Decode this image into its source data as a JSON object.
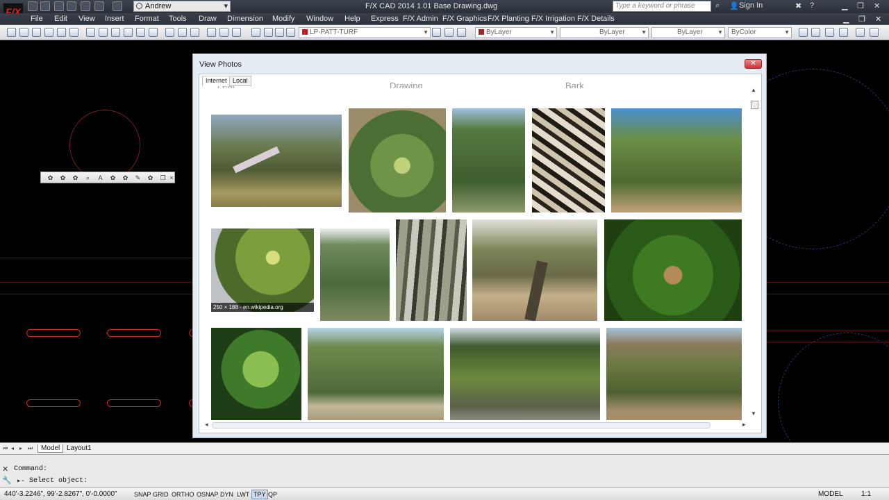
{
  "app": {
    "logo": "F/X",
    "title": "F/X CAD 2014    1.01 Base Drawing.dwg",
    "workspace": "Andrew",
    "search_placeholder": "Type a keyword or phrase",
    "sign_in": "Sign In"
  },
  "menu": [
    "File",
    "Edit",
    "View",
    "Insert",
    "Format",
    "Tools",
    "Draw",
    "Dimension",
    "Modify",
    "Window",
    "Help",
    "Express",
    "F/X Admin",
    "F/X Graphics",
    "F/X Planting",
    "F/X Irrigation",
    "F/X Details"
  ],
  "toolbar": {
    "layer": "LP-PATT-TURF",
    "color": "ByLayer",
    "linetype": "ByLayer",
    "lineweight": "ByLayer",
    "plotstyle": "ByColor",
    "colors": {
      "layer_swatch": "#c02020",
      "color_swatch": "#9a2a2a"
    }
  },
  "dialog": {
    "title": "View Photos",
    "close_label": "✕",
    "tabs": [
      "Internet",
      "Local"
    ],
    "active_tab": "Internet",
    "ghost_headers": [
      "Leaf",
      "Drawing",
      "Bark"
    ],
    "hover_caption": "250 × 188 - en.wikipedia.org",
    "photos": [
      {
        "name": "sprawling-oak-tree",
        "kind": "tree",
        "row": 1
      },
      {
        "name": "oak-leaves-acorn",
        "kind": "leaf",
        "row": 1
      },
      {
        "name": "oak-tree-park",
        "kind": "tree",
        "row": 1
      },
      {
        "name": "oak-branches-bark",
        "kind": "bark",
        "row": 1
      },
      {
        "name": "oak-trail-canopy",
        "kind": "tree",
        "row": 1
      },
      {
        "name": "oak-acorn-branch",
        "kind": "leaf",
        "row": 2
      },
      {
        "name": "oak-shrub-tree",
        "kind": "tree",
        "row": 2
      },
      {
        "name": "oak-forest-trunks",
        "kind": "bark",
        "row": 2
      },
      {
        "name": "oak-trunk-shade",
        "kind": "tree",
        "row": 2
      },
      {
        "name": "oak-acorns-closeup",
        "kind": "leaf",
        "row": 2
      },
      {
        "name": "oak-leaf-cluster",
        "kind": "leaf",
        "row": 3
      },
      {
        "name": "round-oak-field",
        "kind": "tree",
        "row": 3
      },
      {
        "name": "oak-street-trees",
        "kind": "tree",
        "row": 3
      },
      {
        "name": "oak-hillside",
        "kind": "tree",
        "row": 3
      }
    ]
  },
  "layout_tabs": [
    "Model",
    "Layout1"
  ],
  "command": {
    "line1": "Command:",
    "line2": "Select object:"
  },
  "status": {
    "coords": "440'-3.2246\",  99'-2.8267\",  0'-0.0000\"",
    "toggles": [
      {
        "label": "SNAP",
        "on": false
      },
      {
        "label": "GRID",
        "on": false
      },
      {
        "label": "ORTHO",
        "on": false
      },
      {
        "label": "OSNAP",
        "on": false
      },
      {
        "label": "DYN",
        "on": false
      },
      {
        "label": "LWT",
        "on": false
      },
      {
        "label": "TPY",
        "on": true
      },
      {
        "label": "QP",
        "on": false
      }
    ],
    "model": "MODEL",
    "scale": "1:1"
  }
}
